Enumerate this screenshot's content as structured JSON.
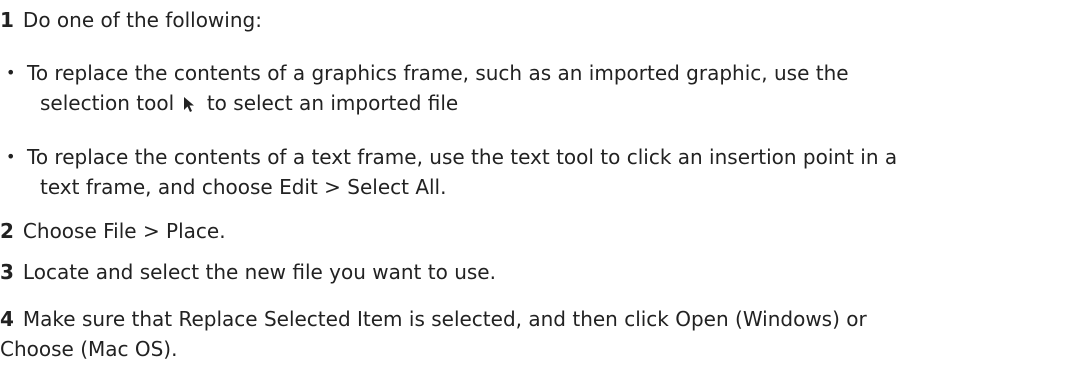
{
  "steps": [
    {
      "num": "1",
      "text": "Do one of the following:"
    },
    {
      "num": "2",
      "text": "Choose File > Place."
    },
    {
      "num": "3",
      "text": "Locate and select the new file you want to use."
    },
    {
      "num": "4",
      "text_line1": "Make sure that Replace Selected Item is selected, and then click Open (Windows) or",
      "text_line2": "Choose (Mac OS)."
    }
  ],
  "bullets": [
    {
      "marker": "•",
      "line1": "To replace the contents of a graphics frame, such as an imported graphic, use the",
      "line2_before": "selection tool",
      "line2_after": "to select an imported file",
      "icon": "selection-tool-arrow-icon"
    },
    {
      "marker": "•",
      "line1": "To replace the contents of a text frame, use the text tool to click an insertion point in a",
      "line2": "text frame, and choose Edit > Select All."
    }
  ]
}
